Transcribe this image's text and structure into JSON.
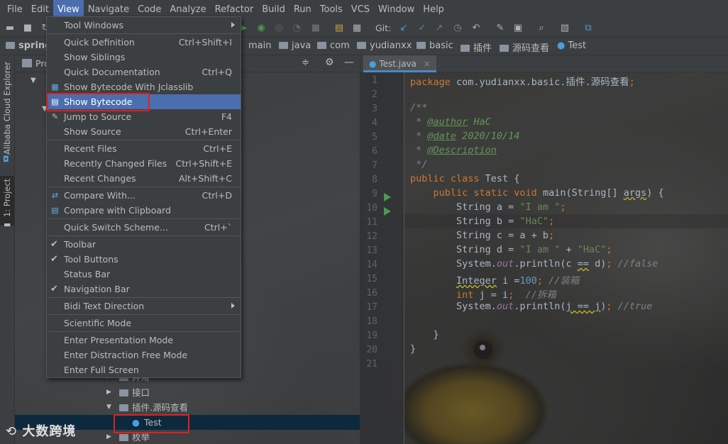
{
  "menubar": [
    "File",
    "Edit",
    "View",
    "Navigate",
    "Code",
    "Analyze",
    "Refactor",
    "Build",
    "Run",
    "Tools",
    "VCS",
    "Window",
    "Help"
  ],
  "toolbar": {
    "git_label": "Git:"
  },
  "navbar": {
    "project": "spring",
    "crumbs": [
      "main",
      "java",
      "com",
      "yudianxx",
      "basic",
      "插件",
      "源码查看",
      "Test"
    ]
  },
  "sidestrip": {
    "alibaba": "Alibaba Cloud Explorer",
    "project": "1: Project"
  },
  "project": {
    "head": "Pro",
    "tree": [
      {
        "label": "异常",
        "expanded": false
      },
      {
        "label": "接口",
        "expanded": false
      },
      {
        "label": "插件.源码查看",
        "expanded": true
      },
      {
        "label": "Test",
        "selected": true
      },
      {
        "label": "枚举",
        "expanded": false
      }
    ]
  },
  "editor": {
    "tab": "Test.java",
    "line_numbers": [
      "1",
      "2",
      "3",
      "4",
      "5",
      "6",
      "7",
      "8",
      "9",
      "10",
      "11",
      "12",
      "13",
      "14",
      "15",
      "16",
      "17",
      "18",
      "19",
      "20",
      "21"
    ]
  },
  "dropdown": {
    "items": [
      {
        "label": "Tool Windows",
        "shortcut": "",
        "submenu": true
      },
      {
        "label": "Quick Definition",
        "shortcut": "Ctrl+Shift+I"
      },
      {
        "label": "Show Siblings",
        "shortcut": ""
      },
      {
        "label": "Quick Documentation",
        "shortcut": "Ctrl+Q"
      },
      {
        "label": "Show Bytecode With Jclasslib",
        "shortcut": ""
      },
      {
        "label": "Show Bytecode",
        "shortcut": "",
        "highlight": true
      },
      {
        "label": "Jump to Source",
        "shortcut": "F4"
      },
      {
        "label": "Show Source",
        "shortcut": "Ctrl+Enter"
      },
      {
        "label": "Recent Files",
        "shortcut": "Ctrl+E"
      },
      {
        "label": "Recently Changed Files",
        "shortcut": "Ctrl+Shift+E"
      },
      {
        "label": "Recent Changes",
        "shortcut": "Alt+Shift+C"
      },
      {
        "label": "Compare With...",
        "shortcut": "Ctrl+D"
      },
      {
        "label": "Compare with Clipboard",
        "shortcut": ""
      },
      {
        "label": "Quick Switch Scheme...",
        "shortcut": "Ctrl+`"
      },
      {
        "label": "Toolbar",
        "shortcut": "",
        "checked": true
      },
      {
        "label": "Tool Buttons",
        "shortcut": "",
        "checked": true
      },
      {
        "label": "Status Bar",
        "shortcut": ""
      },
      {
        "label": "Navigation Bar",
        "shortcut": "",
        "checked": true
      },
      {
        "label": "Bidi Text Direction",
        "shortcut": "",
        "submenu": true
      },
      {
        "label": "Scientific Mode",
        "shortcut": ""
      },
      {
        "label": "Enter Presentation Mode",
        "shortcut": ""
      },
      {
        "label": "Enter Distraction Free Mode",
        "shortcut": ""
      },
      {
        "label": "Enter Full Screen",
        "shortcut": ""
      }
    ]
  },
  "watermark": "大数跨境",
  "colors": {
    "highlight": "#4b6eaf",
    "redbox": "#e02020",
    "keyword": "#cc7832",
    "string": "#6a8759"
  }
}
